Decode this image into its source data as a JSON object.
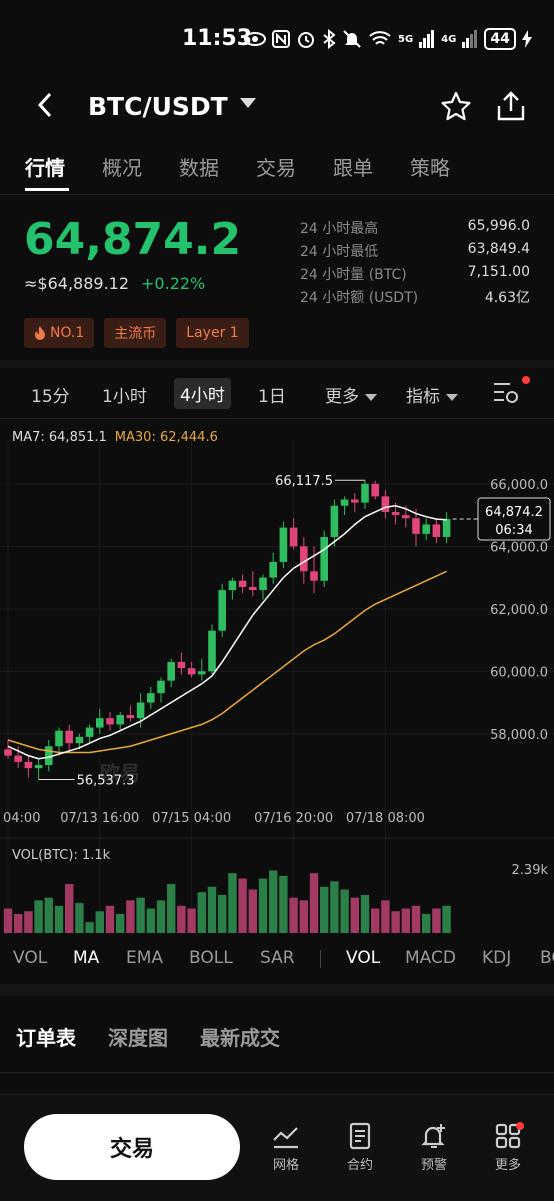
{
  "status": {
    "time": "11:53",
    "battery": "44",
    "net1": "5G",
    "net2": "4G"
  },
  "header": {
    "pair": "BTC/USDT"
  },
  "tabs": [
    "行情",
    "概况",
    "数据",
    "交易",
    "跟单",
    "策略"
  ],
  "price": {
    "last": "64,874.2",
    "approx": "≈$64,889.12",
    "change": "+0.22%"
  },
  "stats": [
    {
      "k": "24 小时最高",
      "v": "65,996.0"
    },
    {
      "k": "24 小时最低",
      "v": "63,849.4"
    },
    {
      "k": "24 小时量 (BTC)",
      "v": "7,151.00"
    },
    {
      "k": "24 小时额 (USDT)",
      "v": "4.63亿"
    }
  ],
  "badges": [
    "NO.1",
    "主流币",
    "Layer 1"
  ],
  "intervals": {
    "m15": "15分",
    "h1": "1小时",
    "h4": "4小时",
    "d1": "1日",
    "more": "更多",
    "indicator": "指标"
  },
  "chart_ma": {
    "ma7": "MA7: 64,851.1",
    "ma30": "MA30: 62,444.6"
  },
  "chart_data": {
    "type": "candlestick",
    "interval": "4h",
    "y_ticks": [
      58000,
      60000,
      62000,
      64000,
      66000
    ],
    "y_tick_labels": [
      "58,000.0",
      "60,000.0",
      "62,000.0",
      "64,000.0",
      "66,000.0"
    ],
    "ylim": [
      56200,
      66700
    ],
    "x_tick_labels": [
      "04:00",
      "07/13 16:00",
      "07/15 04:00",
      "07/16 20:00",
      "07/18 08:00"
    ],
    "x_tick_index": [
      0,
      9,
      18,
      28,
      37
    ],
    "high_label": "66,117.5",
    "low_label": "56,537.3",
    "current_label": "64,874.2",
    "current_countdown": "06:34",
    "watermark": "欧易",
    "colors": {
      "up": "#2fbd5f",
      "down": "#e0457b",
      "ma7": "#ffffff",
      "ma30": "#e9a93c"
    },
    "candles": [
      {
        "o": 57500,
        "h": 57800,
        "l": 57200,
        "c": 57300
      },
      {
        "o": 57300,
        "h": 57600,
        "l": 56900,
        "c": 57100
      },
      {
        "o": 57100,
        "h": 57300,
        "l": 56600,
        "c": 56900
      },
      {
        "o": 56900,
        "h": 57200,
        "l": 56537,
        "c": 57000
      },
      {
        "o": 57000,
        "h": 57800,
        "l": 56800,
        "c": 57600
      },
      {
        "o": 57600,
        "h": 58200,
        "l": 57300,
        "c": 58100
      },
      {
        "o": 58100,
        "h": 58300,
        "l": 57400,
        "c": 57700
      },
      {
        "o": 57700,
        "h": 58000,
        "l": 57500,
        "c": 57900
      },
      {
        "o": 57900,
        "h": 58300,
        "l": 57700,
        "c": 58200
      },
      {
        "o": 58200,
        "h": 58800,
        "l": 58000,
        "c": 58500
      },
      {
        "o": 58500,
        "h": 58700,
        "l": 58100,
        "c": 58300
      },
      {
        "o": 58300,
        "h": 58700,
        "l": 58100,
        "c": 58600
      },
      {
        "o": 58600,
        "h": 58900,
        "l": 58400,
        "c": 58500
      },
      {
        "o": 58500,
        "h": 59300,
        "l": 58200,
        "c": 59000
      },
      {
        "o": 59000,
        "h": 59500,
        "l": 58800,
        "c": 59300
      },
      {
        "o": 59300,
        "h": 59800,
        "l": 59000,
        "c": 59700
      },
      {
        "o": 59700,
        "h": 60400,
        "l": 59500,
        "c": 60300
      },
      {
        "o": 60300,
        "h": 60600,
        "l": 59900,
        "c": 60100
      },
      {
        "o": 60100,
        "h": 60300,
        "l": 59800,
        "c": 59900
      },
      {
        "o": 59900,
        "h": 60400,
        "l": 59700,
        "c": 60000
      },
      {
        "o": 60000,
        "h": 61500,
        "l": 59900,
        "c": 61300
      },
      {
        "o": 61300,
        "h": 62800,
        "l": 61100,
        "c": 62600
      },
      {
        "o": 62600,
        "h": 63000,
        "l": 62300,
        "c": 62900
      },
      {
        "o": 62900,
        "h": 63100,
        "l": 62500,
        "c": 62700
      },
      {
        "o": 62700,
        "h": 63200,
        "l": 62400,
        "c": 62600
      },
      {
        "o": 62600,
        "h": 63100,
        "l": 62300,
        "c": 63000
      },
      {
        "o": 63000,
        "h": 63800,
        "l": 62800,
        "c": 63500
      },
      {
        "o": 63500,
        "h": 64800,
        "l": 63300,
        "c": 64600
      },
      {
        "o": 64600,
        "h": 64900,
        "l": 63900,
        "c": 64000
      },
      {
        "o": 64000,
        "h": 64300,
        "l": 62800,
        "c": 63200
      },
      {
        "o": 63200,
        "h": 64000,
        "l": 62500,
        "c": 62900
      },
      {
        "o": 62900,
        "h": 64500,
        "l": 62700,
        "c": 64300
      },
      {
        "o": 64300,
        "h": 65500,
        "l": 64000,
        "c": 65300
      },
      {
        "o": 65300,
        "h": 65600,
        "l": 65000,
        "c": 65500
      },
      {
        "o": 65500,
        "h": 65700,
        "l": 65100,
        "c": 65400
      },
      {
        "o": 65400,
        "h": 66117,
        "l": 65200,
        "c": 66000
      },
      {
        "o": 66000,
        "h": 66100,
        "l": 65500,
        "c": 65600
      },
      {
        "o": 65600,
        "h": 65800,
        "l": 64900,
        "c": 65100
      },
      {
        "o": 65100,
        "h": 65400,
        "l": 64700,
        "c": 65000
      },
      {
        "o": 65000,
        "h": 65300,
        "l": 64600,
        "c": 64900
      },
      {
        "o": 64900,
        "h": 65200,
        "l": 64000,
        "c": 64400
      },
      {
        "o": 64400,
        "h": 64900,
        "l": 64200,
        "c": 64700
      },
      {
        "o": 64700,
        "h": 64900,
        "l": 64100,
        "c": 64300
      },
      {
        "o": 64300,
        "h": 65100,
        "l": 64100,
        "c": 64874
      }
    ],
    "ma7": [
      57600,
      57450,
      57300,
      57200,
      57250,
      57350,
      57450,
      57550,
      57700,
      57850,
      57950,
      58100,
      58250,
      58400,
      58600,
      58800,
      59000,
      59200,
      59400,
      59600,
      59850,
      60300,
      60800,
      61300,
      61800,
      62200,
      62600,
      63000,
      63300,
      63500,
      63700,
      63900,
      64150,
      64400,
      64700,
      64950,
      65100,
      65250,
      65300,
      65200,
      65050,
      64950,
      64870,
      64851
    ],
    "ma30": [
      57800,
      57700,
      57600,
      57500,
      57450,
      57400,
      57400,
      57400,
      57400,
      57450,
      57500,
      57550,
      57600,
      57700,
      57800,
      57900,
      58000,
      58100,
      58200,
      58300,
      58450,
      58650,
      58900,
      59150,
      59400,
      59650,
      59900,
      60150,
      60400,
      60650,
      60850,
      61000,
      61200,
      61450,
      61700,
      61950,
      62150,
      62300,
      62450,
      62600,
      62750,
      62900,
      63050,
      63200
    ],
    "volume_label": "VOL(BTC): 1.1k",
    "volume_max_label": "2.39k",
    "volume_max": 2390,
    "volumes": [
      900,
      700,
      800,
      1200,
      1300,
      1000,
      1800,
      1100,
      400,
      800,
      1000,
      700,
      1200,
      1300,
      900,
      1200,
      1800,
      1000,
      900,
      1500,
      1700,
      1400,
      2200,
      2000,
      1600,
      2000,
      2300,
      2100,
      1300,
      1200,
      2200,
      1700,
      1900,
      1600,
      1300,
      1400,
      900,
      1200,
      800,
      900,
      1000,
      700,
      900,
      1000
    ]
  },
  "indicators": {
    "vol": "VOL",
    "ma": "MA",
    "ema": "EMA",
    "boll": "BOLL",
    "sar": "SAR",
    "vol2": "VOL",
    "macd": "MACD",
    "kdj": "KDJ",
    "bo": "BO"
  },
  "orderbook_tabs": [
    "订单表",
    "深度图",
    "最新成交"
  ],
  "bottom": {
    "trade": "交易",
    "grid": "网格",
    "contract": "合约",
    "alert": "预警",
    "more": "更多"
  }
}
